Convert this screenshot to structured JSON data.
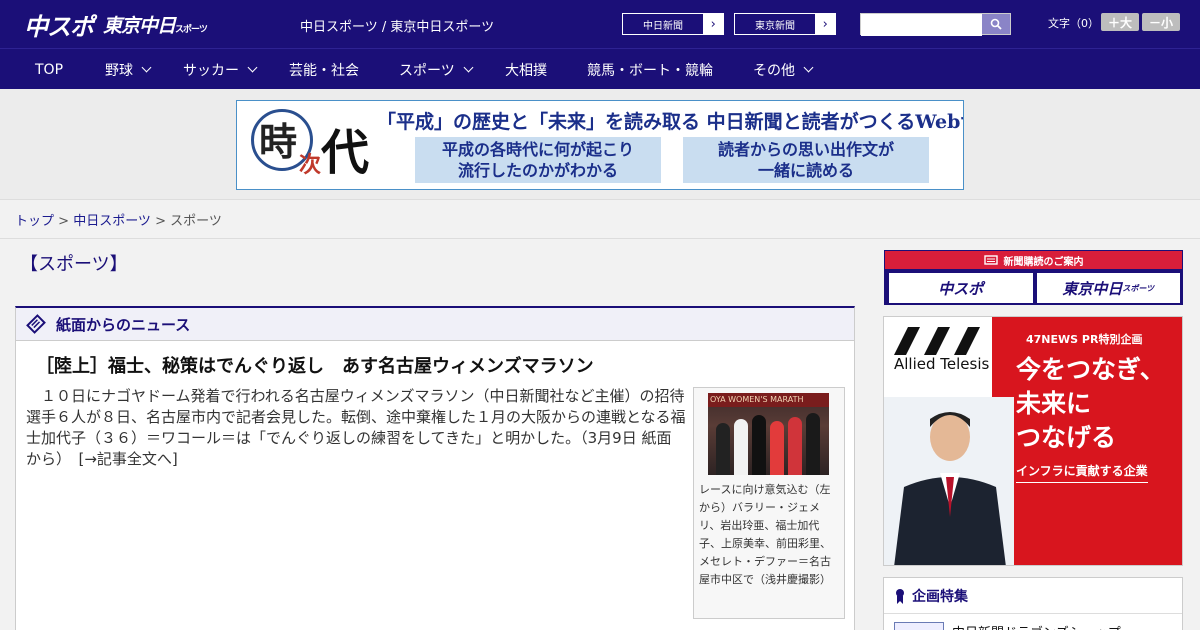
{
  "header": {
    "logo_chuspo": "中スポ",
    "logo_tokyo": "東京中日",
    "logo_tokyo_small": "スポーツ",
    "site_link_1": "中日スポーツ",
    "site_sep": " / ",
    "site_link_2": "東京中日スポーツ",
    "paper_btn_1": "中日新聞",
    "paper_btn_2": "東京新聞",
    "search_placeholder": "",
    "font_size_label": "文字（0）",
    "font_larger": "＋大",
    "font_smaller": "－小"
  },
  "nav": {
    "items": [
      {
        "label": "TOP",
        "has_menu": false
      },
      {
        "label": "野球",
        "has_menu": true
      },
      {
        "label": "サッカー",
        "has_menu": true
      },
      {
        "label": "芸能・社会",
        "has_menu": false
      },
      {
        "label": "スポーツ",
        "has_menu": true
      },
      {
        "label": "大相撲",
        "has_menu": false
      },
      {
        "label": "競馬・ボート・競輪",
        "has_menu": false
      },
      {
        "label": "その他",
        "has_menu": true
      }
    ]
  },
  "banner": {
    "kanji_1": "時",
    "kanji_2": "次",
    "kanji_3": "代",
    "headline": "「平成」の歴史と「未来」を読み取る 中日新聞と読者がつくるWebサイト",
    "box_1_line_1": "平成の各時代に何が起こり",
    "box_1_line_2": "流行したのかがわかる",
    "box_2_line_1": "読者からの思い出作文が",
    "box_2_line_2": "一緒に読める"
  },
  "breadcrumb": {
    "top": "トップ",
    "sep": " > ",
    "parent": "中日スポーツ",
    "current": "スポーツ"
  },
  "main": {
    "section_title": "【スポーツ】",
    "panel_title": "紙面からのニュース",
    "article_title": "［陸上］福士、秘策はでんぐり返し　あす名古屋ウィメンズマラソン",
    "article_body": "　１０日にナゴヤドーム発着で行われる名古屋ウィメンズマラソン（中日新聞社など主催）の招待選手６人が８日、名古屋市内で記者会見した。転倒、途中棄権した１月の大阪からの連戦となる福士加代子（３６）＝ワコール＝は「でんぐり返しの練習をしてきた」と明かした。（3月9日 紙面から）　",
    "read_more": "[→記事全文へ]",
    "photo_banner_text": "OYA WOMEN'S MARATH",
    "photo_caption": "レースに向け意気込む（左から）バラリー・ジェメリ、岩出玲亜、福士加代子、上原美幸、前田彩里、メセレト・デファー＝名古屋市中区で（浅井慶撮影）"
  },
  "sidebar": {
    "subscribe_label": "新聞購読のご案内",
    "subscribe_logo_1": "中スポ",
    "subscribe_logo_2": "東京中日",
    "subscribe_logo_2_small": "スポーツ",
    "ad_brand": "Allied Telesis",
    "ad_pr_label": "47NEWS PR特別企画",
    "ad_copy_1": "今をつなぎ、",
    "ad_copy_2": "未来に",
    "ad_copy_3": "つなげる",
    "ad_tagline": "インフラに貢献する企業",
    "feature_title": "企画特集",
    "feature_item": "中日新聞ドラゴンズショップ"
  },
  "colors": {
    "brand_navy": "#1b0f78",
    "subscribe_red": "#d81e3a",
    "ad_red": "#d8151e",
    "search_button": "#8a84c7"
  }
}
